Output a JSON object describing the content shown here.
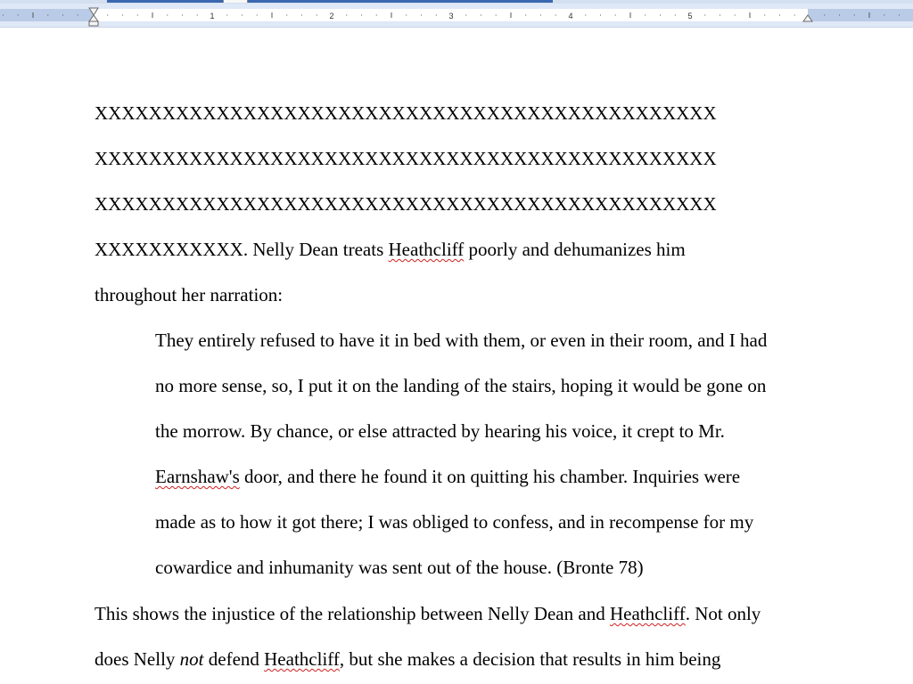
{
  "ruler": {
    "numbers": [
      "1",
      "2",
      "3",
      "4",
      "5"
    ]
  },
  "document": {
    "redacted_lines": [
      "XXXXXXXXXXXXXXXXXXXXXXXXXXXXXXXXXXXXXXXXXXXXXX",
      "XXXXXXXXXXXXXXXXXXXXXXXXXXXXXXXXXXXXXXXXXXXXXX",
      "XXXXXXXXXXXXXXXXXXXXXXXXXXXXXXXXXXXXXXXXXXXXXX"
    ],
    "para1_line4": {
      "a": "XXXXXXXXXXX. Nelly Dean treats ",
      "b": "Heathcliff",
      "c": " poorly and dehumanizes him"
    },
    "para1_line5": "throughout her narration:",
    "quote": {
      "line1": "They entirely refused to have it in bed with them, or even in their room, and I had",
      "line2": "no more sense, so, I put it on the landing of the stairs, hoping it would be gone on",
      "line3": "the morrow. By chance, or else attracted by hearing his voice, it crept to Mr.",
      "line4_a": "Earnshaw's",
      "line4_b": " door, and there he found it on quitting his chamber. Inquiries were",
      "line5": "made as to how it got there; I was obliged to confess, and in recompense for my",
      "line6": "cowardice and inhumanity was sent out of the house. (Bronte 78)"
    },
    "para2_line1": {
      "a": "This shows the injustice of the relationship between Nelly Dean and ",
      "b": "Heathcliff",
      "c": ". Not only"
    },
    "para2_line2": {
      "a": "does Nelly ",
      "b": "not",
      "c": " defend ",
      "d": "Heathcliff",
      "e": ", but she makes a decision that results in him being"
    }
  }
}
